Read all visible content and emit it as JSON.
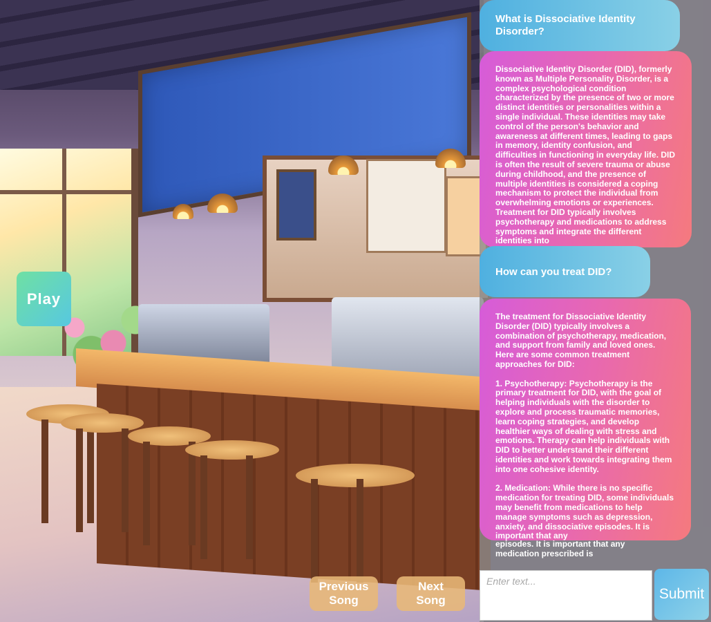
{
  "controls": {
    "play_label": "Play",
    "previous_label": "Previous\nSong",
    "next_label": "Next\nSong",
    "submit_label": "Submit"
  },
  "input": {
    "placeholder": "Enter text...",
    "value": ""
  },
  "chat": {
    "q1": "What is Dissociative Identity Disorder?",
    "a1": "Dissociative Identity Disorder (DID), formerly known as Multiple Personality Disorder, is a complex psychological condition characterized by the presence of two or more distinct identities or personalities within a single individual. These identities may take control of the person's behavior and awareness at different times, leading to gaps in memory, identity confusion, and difficulties in functioning in everyday life. DID is often the result of severe trauma or abuse during childhood, and the presence of multiple identities is considered a coping mechanism to protect the individual from overwhelming emotions or experiences. Treatment for DID typically involves psychotherapy and medications to address symptoms and integrate the different identities into",
    "q2": "How can you treat DID?",
    "a2": "The treatment for Dissociative Identity Disorder (DID) typically involves a combination of psychotherapy, medication, and support from family and loved ones. Here are some common treatment approaches for DID:\n\n1. Psychotherapy: Psychotherapy is the primary treatment for DID, with the goal of helping individuals with the disorder to explore and process traumatic memories, learn coping strategies, and develop healthier ways of dealing with stress and emotions. Therapy can help individuals with DID to better understand their different identities and work towards integrating them into one cohesive identity.\n\n2. Medication: While there is no specific medication for treating DID, some individuals may benefit from medications to help manage symptoms such as depression, anxiety, and dissociative episodes. It is important that any",
    "a2_overflow": "episodes. It is important that any\nmedication prescribed is"
  }
}
